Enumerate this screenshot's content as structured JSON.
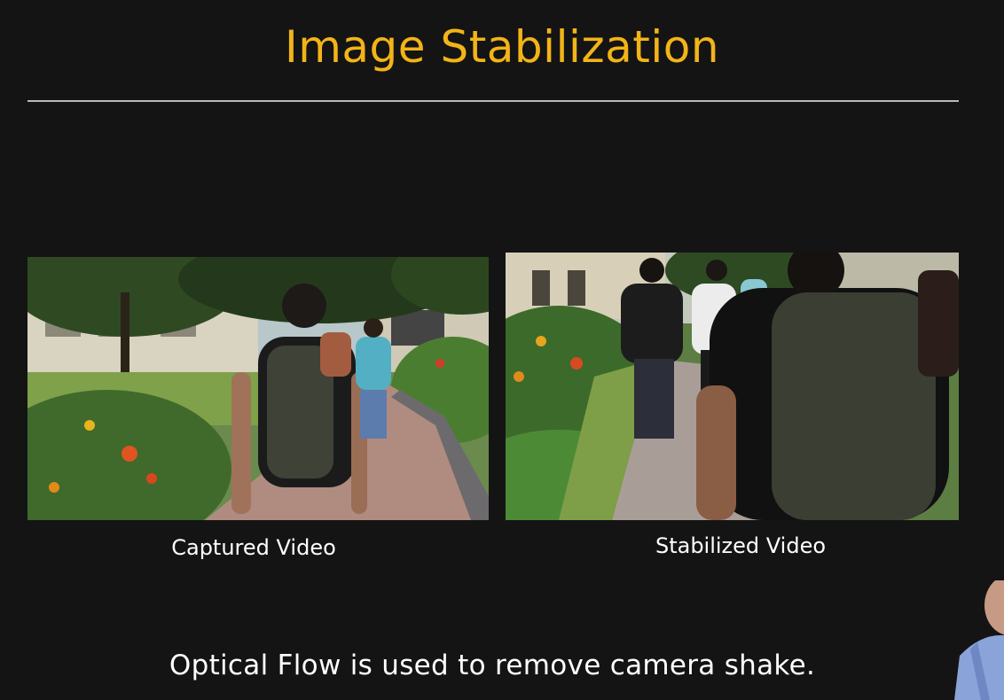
{
  "slide": {
    "title": "Image Stabilization",
    "footer": "Optical Flow is used to remove camera shake."
  },
  "videos": [
    {
      "caption": "Captured Video"
    },
    {
      "caption": "Stabilized Video"
    }
  ],
  "colors": {
    "background": "#141414",
    "title": "#f2b417",
    "text": "#ffffff",
    "rule": "#b9b9b9"
  }
}
